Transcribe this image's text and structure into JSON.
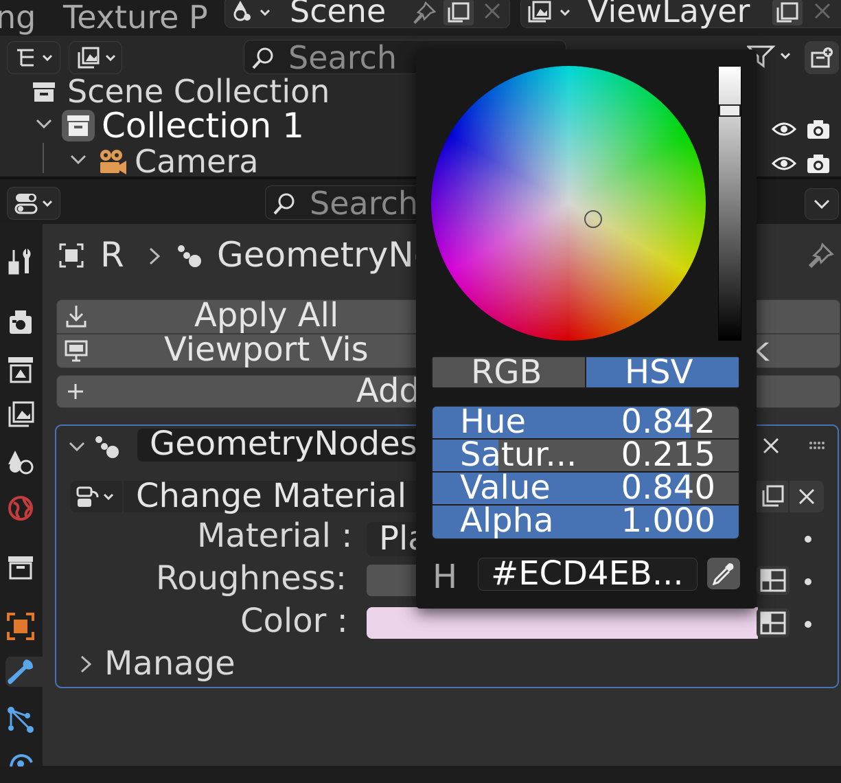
{
  "header": {
    "tab_fragment_1": "ng",
    "tab_texture": "Texture P",
    "scene_name": "Scene",
    "view_layer_name": "ViewLayer"
  },
  "outliner": {
    "search_placeholder": "Search",
    "items": [
      {
        "label": "Scene Collection"
      },
      {
        "label": "Collection 1"
      },
      {
        "label": "Camera"
      }
    ]
  },
  "properties": {
    "search_placeholder": "Search",
    "breadcrumb": {
      "object": "R",
      "modifier": "GeometryNo"
    },
    "apply_all": "Apply All",
    "viewport_vis": "Viewport Vis",
    "right_k": "k",
    "add_label": "Add",
    "modifier": {
      "name": "GeometryNodes",
      "node_group": "Change Material",
      "inputs": [
        {
          "label": "Material :",
          "value": "Pla"
        },
        {
          "label": "Roughness:",
          "value": ""
        },
        {
          "label": "Color :",
          "value": ""
        }
      ],
      "manage_label": "Manage"
    }
  },
  "color_picker": {
    "mode_tabs": [
      "RGB",
      "HSV"
    ],
    "active_mode": "HSV",
    "sliders": [
      {
        "label": "Hue",
        "value": "0.842",
        "fraction": 0.842
      },
      {
        "label": "Satur...",
        "value": "0.215",
        "fraction": 0.215
      },
      {
        "label": "Value",
        "value": "0.840",
        "fraction": 0.84
      },
      {
        "label": "Alpha",
        "value": "1.000",
        "fraction": 1.0
      }
    ],
    "hex_prefix": "H",
    "hex_value": "#ECD4EB...",
    "hsv": {
      "h": 0.842,
      "s": 0.215,
      "v": 0.84
    },
    "swatch_color": "#ecd4eb"
  },
  "colors": {
    "accent": "#4772b3",
    "camera_orange": "#e09a52",
    "object_orange": "#e0782e",
    "world_red": "#c43c3c",
    "tool_blue": "#5aa6ec",
    "data_blue": "#5aa6ec"
  }
}
